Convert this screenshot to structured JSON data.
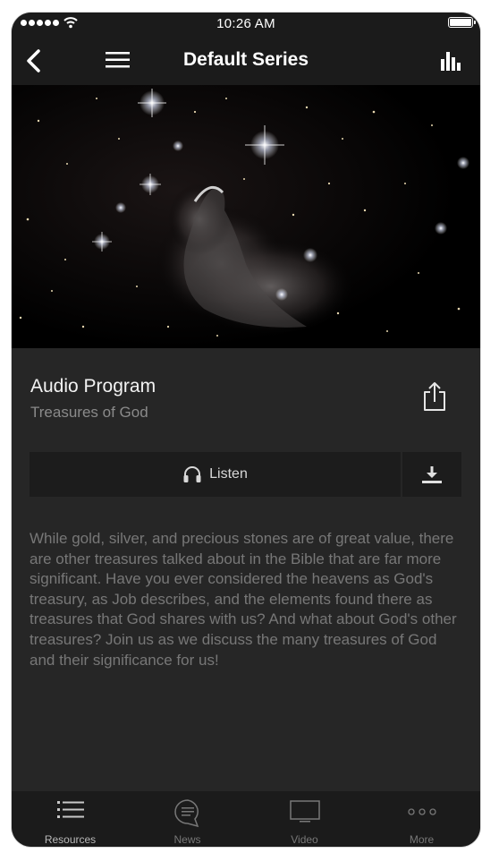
{
  "status_bar": {
    "time": "10:26 AM",
    "icons": [
      "signal-dots-icon",
      "wifi-icon",
      "battery-icon"
    ]
  },
  "nav": {
    "title": "Default Series",
    "icons": [
      "back-chevron-icon",
      "hamburger-menu-icon",
      "bar-chart-icon"
    ]
  },
  "hero": {
    "image": "starfield-nebula"
  },
  "program": {
    "type_label": "Audio Program",
    "title": "Treasures of God",
    "share_icon": "share-icon"
  },
  "actions": {
    "listen_label": "Listen",
    "listen_icon": "headphones-icon",
    "download_icon": "download-icon"
  },
  "description": "While gold, silver, and precious stones are of great value, there are other treasures talked about in the Bible that are far more significant. Have you ever considered the heavens as God's treasury, as Job describes, and the elements found there as treasures that God shares with us? And what about God's other treasures? Join us as we discuss the many treasures of God and their significance for us!",
  "tabs": [
    {
      "label": "Resources",
      "icon": "list-icon",
      "active": true
    },
    {
      "label": "News",
      "icon": "chat-bubble-icon",
      "active": false
    },
    {
      "label": "Video",
      "icon": "tv-icon",
      "active": false
    },
    {
      "label": "More",
      "icon": "ellipsis-icon",
      "active": false
    }
  ],
  "colors": {
    "background": "#262626",
    "bars": "#1b1b1b",
    "button": "#1c1c1c",
    "title_text": "#f2f2f2",
    "muted_text": "#8a8a8a",
    "description_text": "#777777"
  }
}
